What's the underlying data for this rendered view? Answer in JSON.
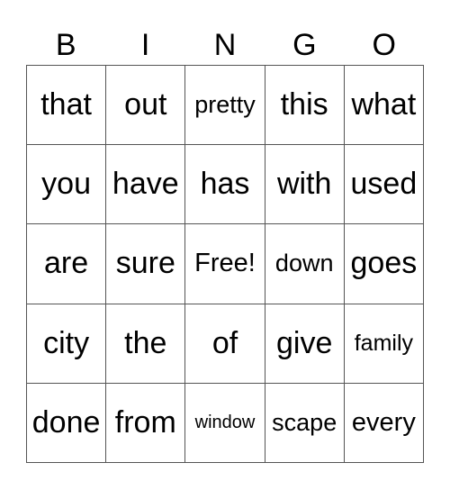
{
  "header": [
    "B",
    "I",
    "N",
    "G",
    "O"
  ],
  "cells": [
    [
      "that",
      "out",
      "pretty",
      "this",
      "what"
    ],
    [
      "you",
      "have",
      "has",
      "with",
      "used"
    ],
    [
      "are",
      "sure",
      "Free!",
      "down",
      "goes"
    ],
    [
      "city",
      "the",
      "of",
      "give",
      "family"
    ],
    [
      "done",
      "from",
      "window",
      "scape",
      "every"
    ]
  ]
}
